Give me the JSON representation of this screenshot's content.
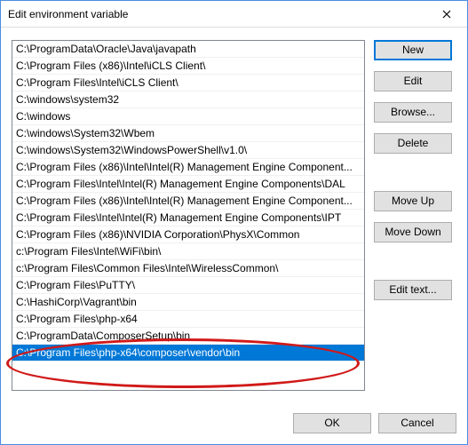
{
  "window": {
    "title": "Edit environment variable"
  },
  "list": {
    "items": [
      "C:\\ProgramData\\Oracle\\Java\\javapath",
      "C:\\Program Files (x86)\\Intel\\iCLS Client\\",
      "C:\\Program Files\\Intel\\iCLS Client\\",
      "C:\\windows\\system32",
      "C:\\windows",
      "C:\\windows\\System32\\Wbem",
      "C:\\windows\\System32\\WindowsPowerShell\\v1.0\\",
      "C:\\Program Files (x86)\\Intel\\Intel(R) Management Engine Component...",
      "C:\\Program Files\\Intel\\Intel(R) Management Engine Components\\DAL",
      "C:\\Program Files (x86)\\Intel\\Intel(R) Management Engine Component...",
      "C:\\Program Files\\Intel\\Intel(R) Management Engine Components\\IPT",
      "C:\\Program Files (x86)\\NVIDIA Corporation\\PhysX\\Common",
      "c:\\Program Files\\Intel\\WiFi\\bin\\",
      "c:\\Program Files\\Common Files\\Intel\\WirelessCommon\\",
      "C:\\Program Files\\PuTTY\\",
      "C:\\HashiCorp\\Vagrant\\bin",
      "C:\\Program Files\\php-x64",
      "C:\\ProgramData\\ComposerSetup\\bin",
      "C:\\Program Files\\php-x64\\composer\\vendor\\bin"
    ],
    "selected_index": 18
  },
  "buttons": {
    "new": "New",
    "edit": "Edit",
    "browse": "Browse...",
    "delete": "Delete",
    "move_up": "Move Up",
    "move_down": "Move Down",
    "edit_text": "Edit text...",
    "ok": "OK",
    "cancel": "Cancel"
  }
}
